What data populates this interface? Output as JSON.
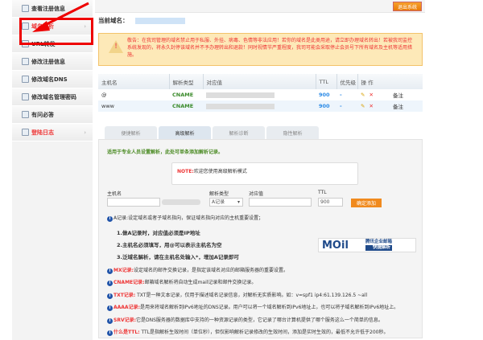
{
  "sidebar": {
    "items": [
      {
        "label": "查看注册信息"
      },
      {
        "label": "域名解析"
      },
      {
        "label": "URL转发"
      },
      {
        "label": "修改注册信息"
      },
      {
        "label": "修改域名DNS"
      },
      {
        "label": "修改域名管理密码"
      },
      {
        "label": "有问必答"
      },
      {
        "label": "登陆日志"
      }
    ]
  },
  "header": {
    "logout": "退出系统",
    "domain_label": "当前域名："
  },
  "warning": "敬告：在我司管理的域名禁止用于私服、外挂、病毒、色情等非法应用！若你的域名是此类用途，请立即办理域名转出！若被我司监控系统发现的，将永久封停该域名并不予办理转出和退款！同时视情节严重程度，我司可能会采取停止会员号下所有域名及主机等适用措施。",
  "table": {
    "headers": [
      "主机名",
      "解析类型",
      "对应值",
      "TTL",
      "优先级",
      "操 作",
      ""
    ],
    "rows": [
      {
        "host": "@",
        "type": "CNAME",
        "ttl": "900",
        "priority": "-",
        "note": "备注"
      },
      {
        "host": "www",
        "type": "CNAME",
        "ttl": "900",
        "priority": "-",
        "note": "备注"
      }
    ]
  },
  "tabs": [
    "便捷解析",
    "高级解析",
    "解析诊断",
    "隐性解析"
  ],
  "panel": {
    "intro": "适用于专业人员设置解析，此处可单条添加解析记录。",
    "note_label": "NOTE:",
    "note_text": "欢迎您使用高级解析模式",
    "labels": {
      "host": "主机名",
      "type": "解析类型",
      "value": "对应值",
      "ttl": "TTL"
    },
    "type_value": "A记录",
    "ttl_value": "900",
    "add": "确定添加",
    "a_record": "A记录:设定域名或者子域名指向，保证域名指向对应的主机重要设置；",
    "steps": [
      "1.做A记录时，对应值必须是IP地址",
      "2.主机名必须填写，用@可以表示主机名为空",
      "3.泛域名解析，请在主机名处输入*，增加A记录即可"
    ],
    "mail": {
      "logo": "MOil",
      "title": "腾讯企业邮箱",
      "sub": "快捷解析"
    },
    "infos": [
      {
        "k": "MX记录:",
        "v": "设定域名的邮件交换记录，是指定该域名对应的邮箱服务器的重要设置。"
      },
      {
        "k": "CNAME记录:",
        "v": "邮箱域名解析将自动生成mail记录和邮件交换记录。"
      },
      {
        "k": "TXT记录:",
        "v": " TXT是一种文本记录，仅用于描述域名记录信息，对解析无实质影响。如：v=spf1 ip4:61.139.126.5 ~all"
      },
      {
        "k": "AAAA记录:",
        "v": "是用来将域名解析到IPv6地址的DNS记录。用户可以将一个域名解析到IPv6地址上，也可以将子域名解析到IPv6地址上。"
      },
      {
        "k": "SRV记录:",
        "v": "它是DNS服务器的数据库中支持的一种资源记录的类型，它记录了哪台计算机提供了哪个服务这么一个简单的信息。"
      },
      {
        "k": "什么是TTL:",
        "v": " TTL是指解析生效时间（单位秒），但仅影响解析记录修改的生效时间，添加是实时生效的，最低不允许低于200秒。"
      }
    ]
  }
}
